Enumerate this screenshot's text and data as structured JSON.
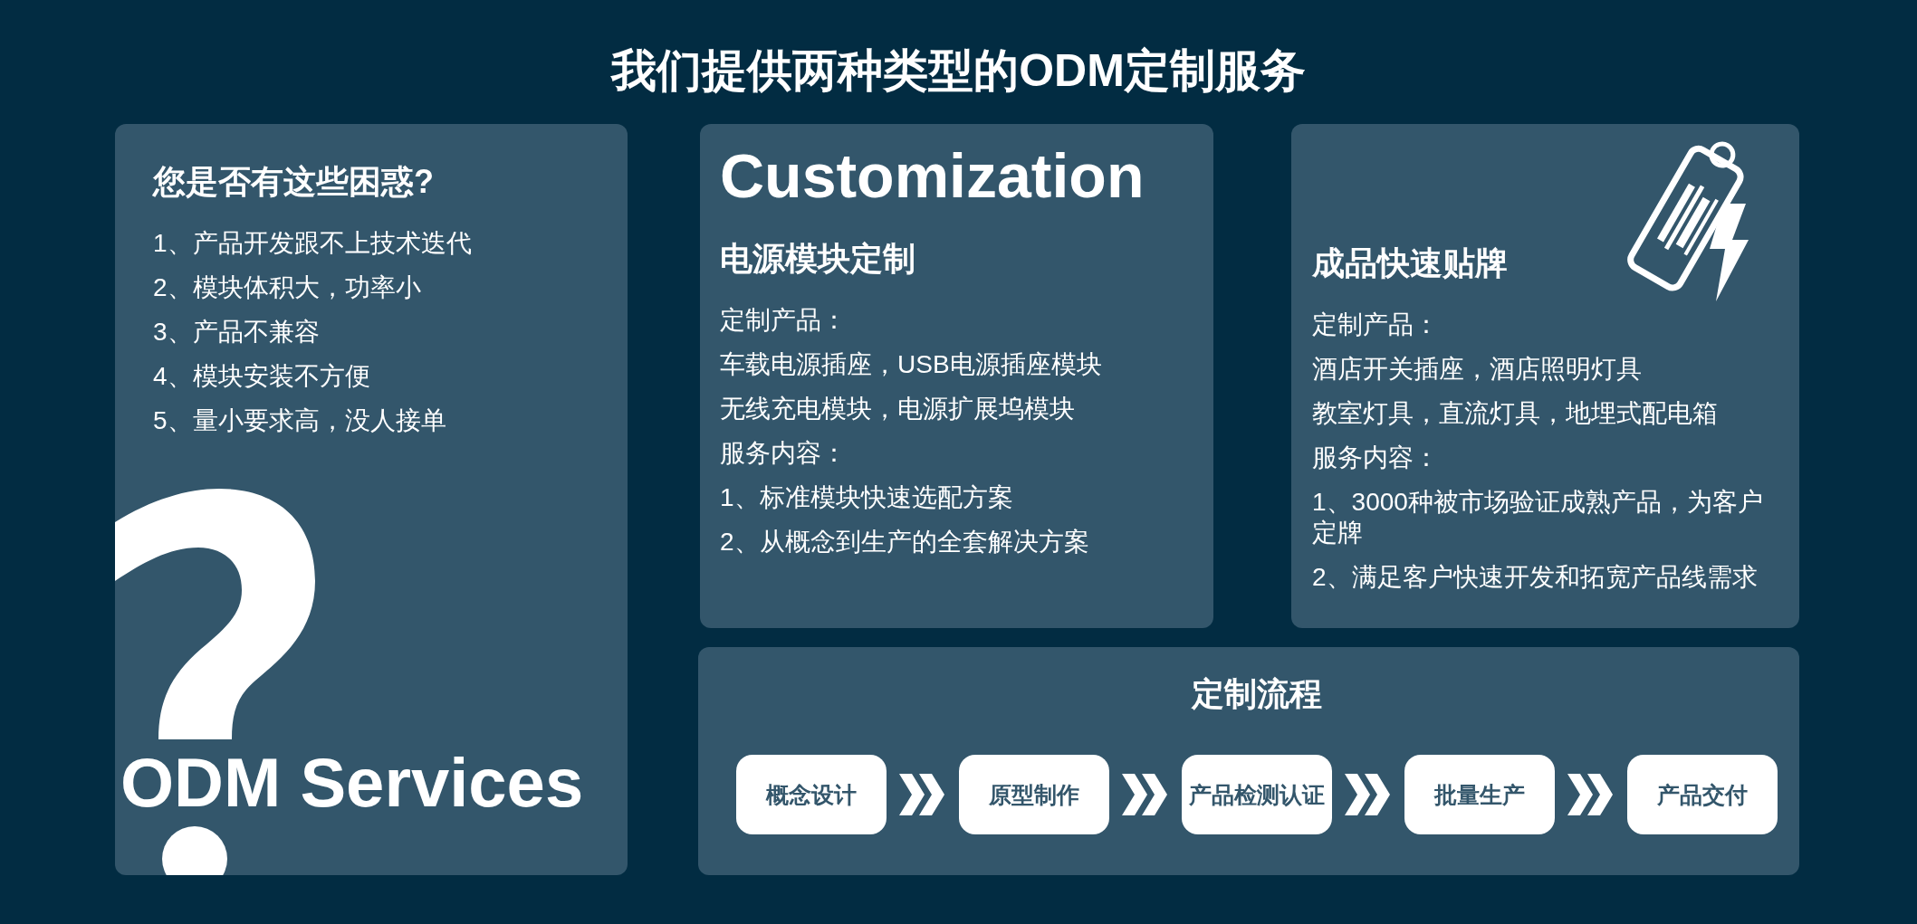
{
  "title": "我们提供两种类型的ODM定制服务",
  "problems": {
    "heading": "您是否有这些困惑?",
    "items": [
      "1、产品开发跟不上技术迭代",
      "2、模块体积大，功率小",
      "3、产品不兼容",
      "4、模块安装不方便",
      "5、量小要求高，没人接单"
    ],
    "caption": "ODM Services"
  },
  "customization": {
    "label": "Customization",
    "heading": "电源模块定制",
    "lines": [
      "定制产品：",
      "车载电源插座，USB电源插座模块",
      "无线充电模块，电源扩展坞模块",
      "服务内容：",
      "1、标准模块快速选配方案",
      "2、从概念到生产的全套解决方案"
    ]
  },
  "quick_labeling": {
    "heading": "成品快速贴牌",
    "lines": [
      "定制产品：",
      "酒店开关插座，酒店照明灯具",
      "教室灯具，直流灯具，地埋式配电箱",
      "服务内容：",
      "1、3000种被市场验证成熟产品，为客户定牌",
      "2、满足客户快速开发和拓宽产品线需求"
    ]
  },
  "process": {
    "heading": "定制流程",
    "steps": [
      "概念设计",
      "原型制作",
      "产品检测认证",
      "批量生产",
      "产品交付"
    ]
  }
}
